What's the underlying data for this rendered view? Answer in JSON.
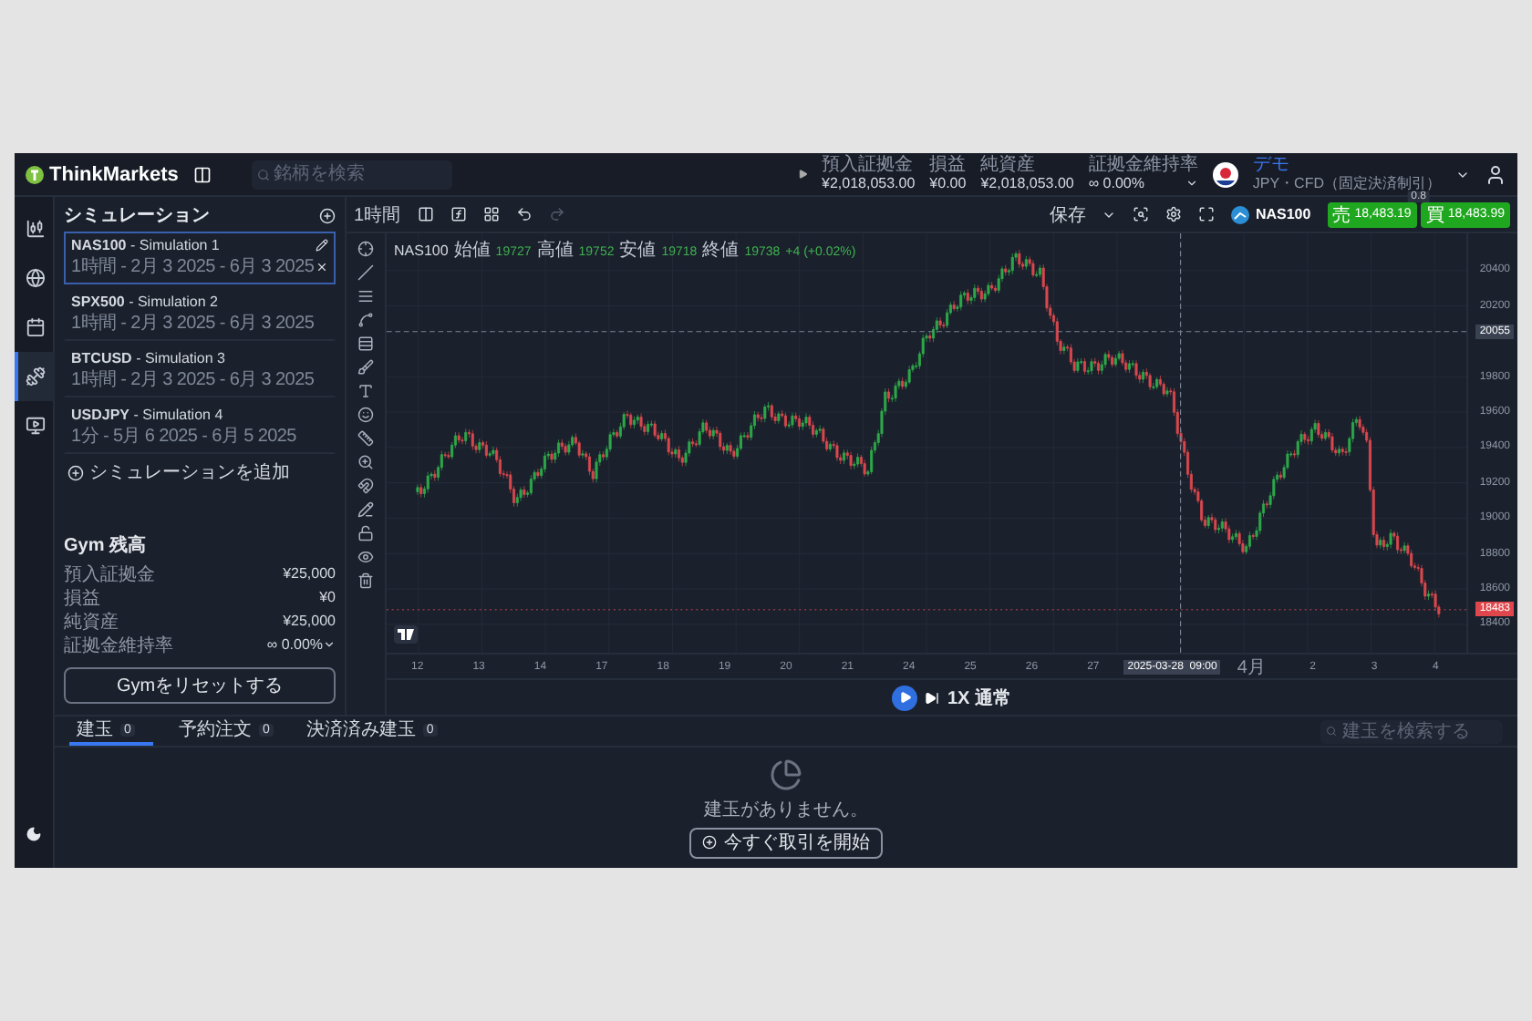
{
  "header": {
    "logo": "ThinkMarkets",
    "search_placeholder": "銘柄を検索",
    "stats": [
      {
        "label": "預入証拠金",
        "value": "¥2,018,053.00"
      },
      {
        "label": "損益",
        "value": "¥0.00"
      },
      {
        "label": "純資産",
        "value": "¥2,018,053.00"
      },
      {
        "label": "証拠金維持率",
        "value": "∞ 0.00%"
      }
    ],
    "account": {
      "name": "デモ",
      "detail": "JPY・CFD（固定決済制引）"
    }
  },
  "nav": [
    {
      "selected": false
    },
    {
      "selected": false
    },
    {
      "selected": false
    },
    {
      "selected": true
    },
    {
      "selected": false
    }
  ],
  "simulations": {
    "title": "シミュレーション",
    "items": [
      {
        "name": "**NAS100** - Simulation 1",
        "range": "1時間 - 2月 3 2025 - 6月 3 2025",
        "selected": true
      },
      {
        "name": "**SPX500** - Simulation 2",
        "range": "1時間 - 2月 3 2025 - 6月 3 2025",
        "selected": false
      },
      {
        "name": "**BTCUSD** - Simulation 3",
        "range": "1時間 - 2月 3 2025 - 6月 3 2025",
        "selected": false
      },
      {
        "name": "**USDJPY** - Simulation 4",
        "range": "1分 - 5月 6 2025 - 6月 5 2025",
        "selected": false
      }
    ],
    "add": "シミュレーションを追加"
  },
  "gym": {
    "title": "Gym 残高",
    "rows": [
      {
        "label": "預入証拠金",
        "value": "¥25,000"
      },
      {
        "label": "損益",
        "value": "¥0"
      },
      {
        "label": "純資産",
        "value": "¥25,000"
      },
      {
        "label": "証拠金維持率",
        "value": "∞ 0.00%"
      }
    ],
    "reset": "Gymをリセットする"
  },
  "toolbar": {
    "interval": "1時間",
    "save": "保存",
    "symbol": "NAS100",
    "sell": {
      "side": "売",
      "price": "18,483.19"
    },
    "spread": "0.8",
    "buy": {
      "side": "買",
      "price": "18,483.99"
    }
  },
  "legend": {
    "symbol": "NAS100",
    "values": [
      {
        "label": "始値",
        "value": "19727"
      },
      {
        "label": "高値",
        "value": "19752"
      },
      {
        "label": "安値",
        "value": "19718"
      },
      {
        "label": "終値",
        "value": "19738"
      }
    ],
    "change": "+4 (+0.02%)"
  },
  "price_axis": [
    {
      "label": "20400",
      "kind": "tick"
    },
    {
      "label": "20200",
      "kind": "tick"
    },
    {
      "label": "20055",
      "kind": "crosshair"
    },
    {
      "label": "19800",
      "kind": "tick"
    },
    {
      "label": "19600",
      "kind": "tick"
    },
    {
      "label": "19400",
      "kind": "tick"
    },
    {
      "label": "19200",
      "kind": "tick"
    },
    {
      "label": "19000",
      "kind": "tick"
    },
    {
      "label": "18800",
      "kind": "tick"
    },
    {
      "label": "18600",
      "kind": "tick"
    },
    {
      "label": "18483",
      "kind": "last"
    },
    {
      "label": "18400",
      "kind": "tick"
    }
  ],
  "time_axis": [
    {
      "label": "12",
      "kind": "tick"
    },
    {
      "label": "13",
      "kind": "tick"
    },
    {
      "label": "14",
      "kind": "tick"
    },
    {
      "label": "17",
      "kind": "tick"
    },
    {
      "label": "18",
      "kind": "tick"
    },
    {
      "label": "19",
      "kind": "tick"
    },
    {
      "label": "20",
      "kind": "tick"
    },
    {
      "label": "21",
      "kind": "tick"
    },
    {
      "label": "24",
      "kind": "tick"
    },
    {
      "label": "25",
      "kind": "tick"
    },
    {
      "label": "26",
      "kind": "tick"
    },
    {
      "label": "27",
      "kind": "tick"
    },
    {
      "label": "2025-03-28  09:00",
      "kind": "cursor"
    },
    {
      "label": "4月",
      "kind": "tick"
    },
    {
      "label": "2",
      "kind": "tick"
    },
    {
      "label": "3",
      "kind": "tick"
    },
    {
      "label": "4",
      "kind": "tick"
    }
  ],
  "playback": {
    "speed": "1X 通常"
  },
  "positions": {
    "tabs": [
      {
        "label": "建玉",
        "count": "0",
        "selected": true
      },
      {
        "label": "予約注文",
        "count": "0",
        "selected": false
      },
      {
        "label": "決済済み建玉",
        "count": "0",
        "selected": false
      }
    ],
    "search_placeholder": "建玉を検索する",
    "empty": "建玉がありません。",
    "start": "今すぐ取引を開始"
  }
}
